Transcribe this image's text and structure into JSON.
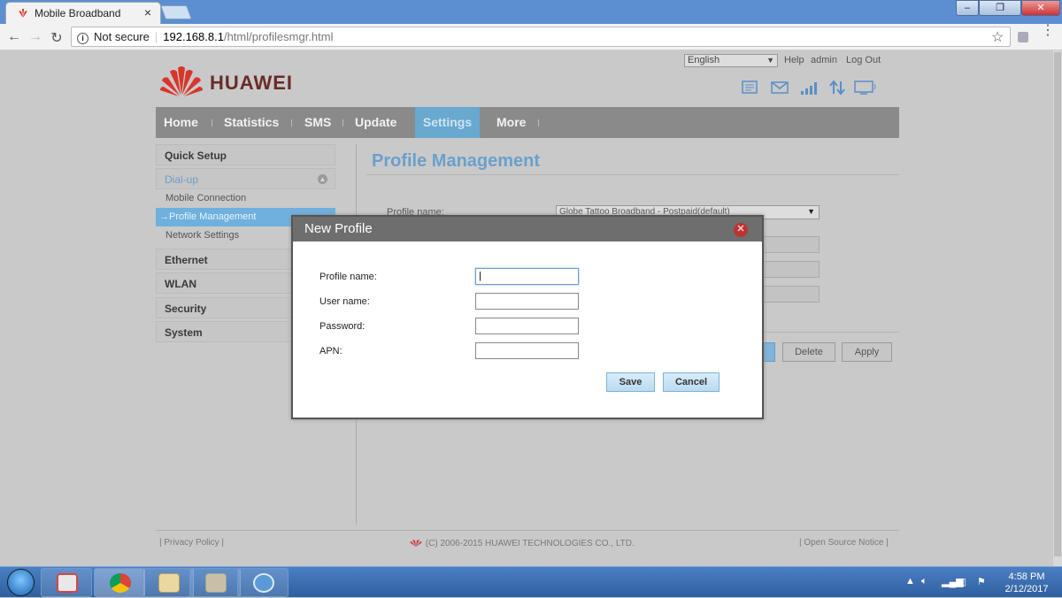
{
  "browser": {
    "tab_title": "Mobile Broadband",
    "tab_close": "×",
    "window_controls": [
      "–",
      "❐",
      "✕"
    ],
    "security_label": "Not secure",
    "url_host": "192.168.8.1",
    "url_path": "/html/profilesmgr.html"
  },
  "header": {
    "brand": "HUAWEI",
    "language": "English",
    "links": [
      "Help",
      "admin",
      "Log Out"
    ],
    "status_icons": [
      "message-icon",
      "mail-icon",
      "signal-icon",
      "data-transfer-icon",
      "computer-icon"
    ]
  },
  "nav": {
    "items": [
      "Home",
      "Statistics",
      "SMS",
      "Update",
      "Settings",
      "More"
    ],
    "active": "Settings"
  },
  "sidebar": {
    "quick_setup": "Quick Setup",
    "dialup": "Dial-up",
    "dialup_items": [
      "Mobile Connection",
      "Profile Management",
      "Network Settings"
    ],
    "selected_prefix": "→",
    "sections": [
      "Ethernet",
      "WLAN",
      "Security",
      "System"
    ]
  },
  "main": {
    "title": "Profile Management",
    "profile_label": "Profile name:",
    "profile_value": "Globe Tattoo Broadband - Postpaid(default)",
    "buttons": [
      "Delete",
      "Apply"
    ]
  },
  "dialog": {
    "title": "New Profile",
    "fields": [
      {
        "label": "Profile name:",
        "value": "",
        "focused": true
      },
      {
        "label": "User name:",
        "value": ""
      },
      {
        "label": "Password:",
        "value": ""
      },
      {
        "label": "APN:",
        "value": ""
      }
    ],
    "save": "Save",
    "cancel": "Cancel"
  },
  "footer": {
    "privacy": "Privacy Policy",
    "copyright": "(C) 2006-2015 HUAWEI TECHNOLOGIES CO., LTD.",
    "open_source": "Open Source Notice"
  },
  "taskbar": {
    "time": "4:58 PM",
    "date": "2/12/2017",
    "pinned": [
      "media-player-icon",
      "chrome-icon",
      "file-explorer-icon",
      "folder-icon",
      "network-app-icon"
    ]
  },
  "colors": {
    "nav_bg": "#8a8a8a",
    "nav_active": "#69a8cf",
    "title_blue": "#6aa0cc",
    "dialog_header": "#6e6e6e"
  }
}
